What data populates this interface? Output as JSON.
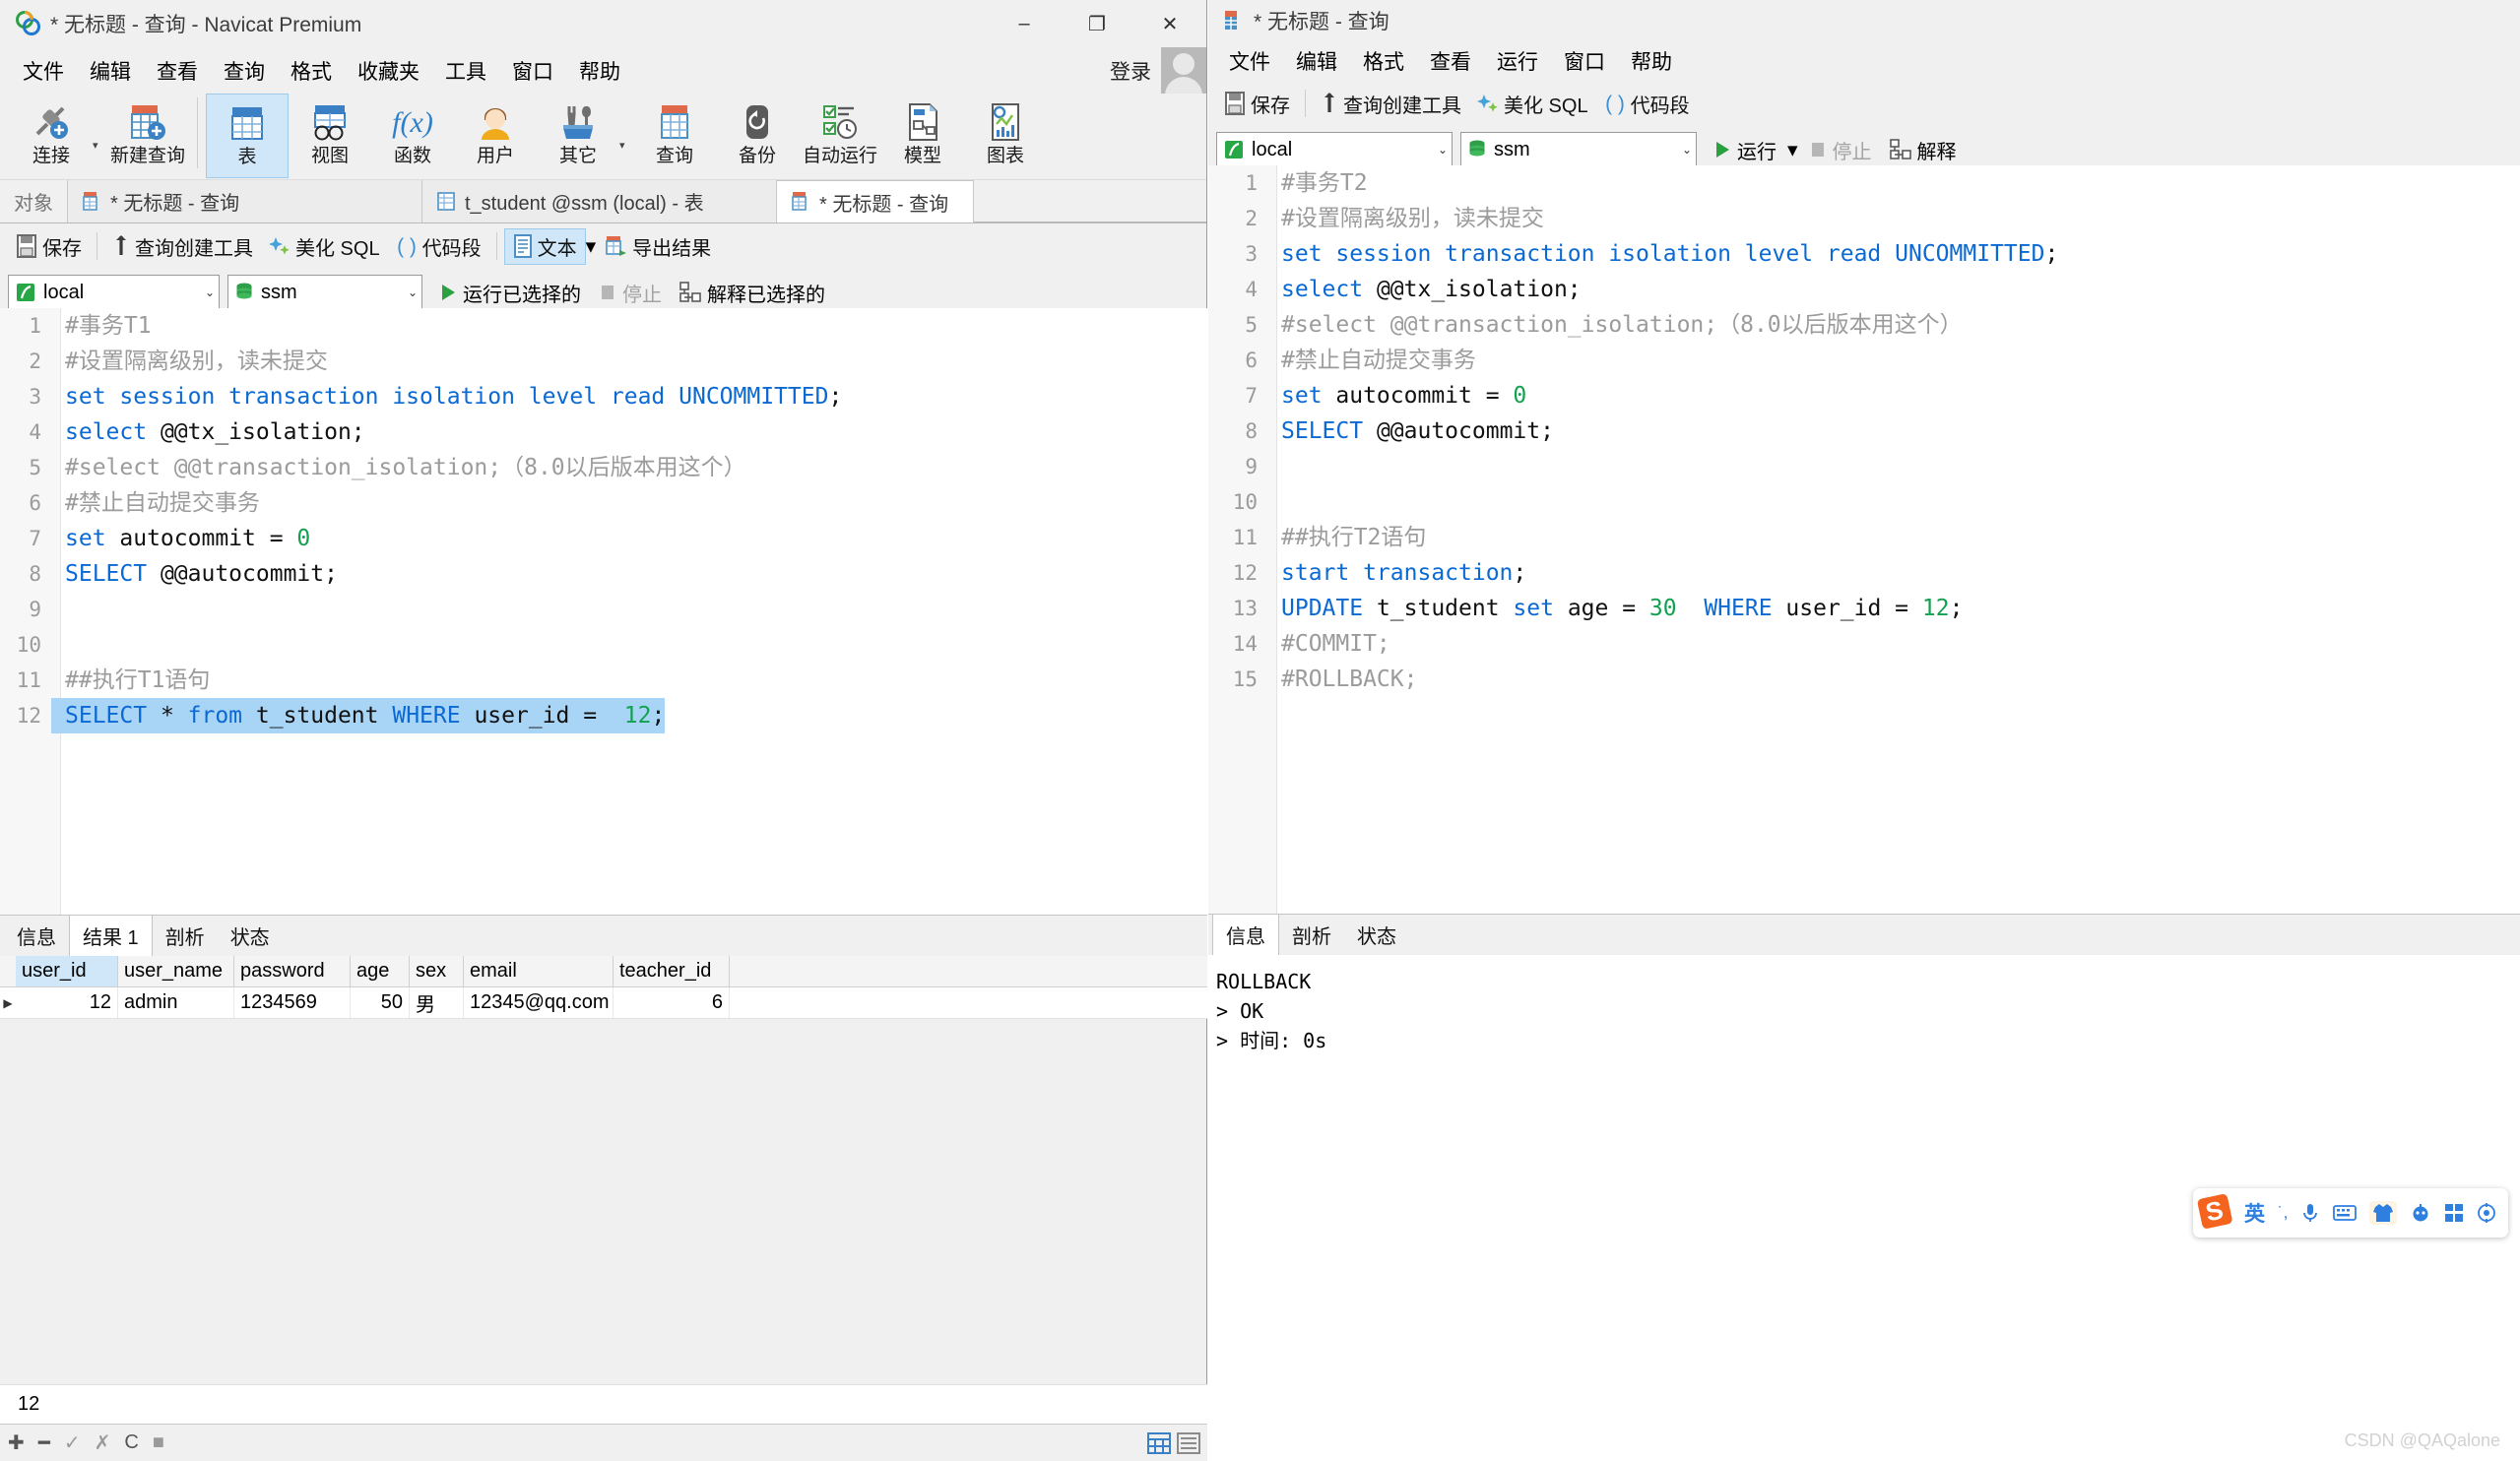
{
  "left_window": {
    "title": "* 无标题 - 查询 - Navicat Premium",
    "window_buttons": {
      "minimize": "–",
      "maximize": "❐",
      "close": "✕"
    },
    "menu": [
      "文件",
      "编辑",
      "查看",
      "查询",
      "格式",
      "收藏夹",
      "工具",
      "窗口",
      "帮助"
    ],
    "login_label": "登录",
    "toolbar": [
      {
        "label": "连接",
        "icon": "connection-icon",
        "caret": true
      },
      {
        "label": "新建查询",
        "icon": "new-query-icon",
        "caret": false
      },
      {
        "label": "表",
        "icon": "table-icon",
        "selected": true
      },
      {
        "label": "视图",
        "icon": "view-icon",
        "selected": false
      },
      {
        "label": "函数",
        "icon": "function-icon",
        "selected": false
      },
      {
        "label": "用户",
        "icon": "user-icon",
        "selected": false
      },
      {
        "label": "其它",
        "icon": "other-icon",
        "caret": true
      },
      {
        "label": "查询",
        "icon": "query-icon",
        "selected": false
      },
      {
        "label": "备份",
        "icon": "backup-icon",
        "selected": false
      },
      {
        "label": "自动运行",
        "icon": "automation-icon",
        "selected": false
      },
      {
        "label": "模型",
        "icon": "model-icon",
        "selected": false
      },
      {
        "label": "图表",
        "icon": "chart-icon",
        "selected": false
      }
    ],
    "tabs": [
      {
        "label": "对象",
        "icon": "object-icon",
        "active": false
      },
      {
        "label": "* 无标题 - 查询",
        "icon": "query-tab-icon",
        "active": false
      },
      {
        "label": "t_student @ssm (local) - 表",
        "icon": "table-tab-icon",
        "active": false
      },
      {
        "label": "* 无标题 - 查询",
        "icon": "query-tab-icon",
        "active": true
      }
    ],
    "subtoolbar": [
      {
        "label": "保存",
        "icon": "save-icon",
        "selected": false
      },
      {
        "label": "查询创建工具",
        "icon": "query-builder-icon",
        "selected": false
      },
      {
        "label": "美化 SQL",
        "icon": "beautify-sql-icon",
        "selected": false
      },
      {
        "label": "代码段",
        "icon": "code-snippet-icon",
        "selected": false
      },
      {
        "label": "文本",
        "icon": "text-icon",
        "selected": true,
        "caret": true
      },
      {
        "label": "导出结果",
        "icon": "export-result-icon",
        "selected": false
      }
    ],
    "connection": {
      "server": "local",
      "database": "ssm"
    },
    "run_buttons": [
      {
        "label": "运行已选择的",
        "icon": "play-icon",
        "disabled": false
      },
      {
        "label": "停止",
        "icon": "stop-icon",
        "disabled": true
      },
      {
        "label": "解释已选择的",
        "icon": "explain-icon",
        "disabled": false
      }
    ],
    "code_lines": [
      {
        "n": "1",
        "segs": [
          {
            "t": "#事务T1",
            "c": "cmt"
          }
        ]
      },
      {
        "n": "2",
        "segs": [
          {
            "t": "#设置隔离级别，读未提交",
            "c": "cmt"
          }
        ]
      },
      {
        "n": "3",
        "segs": [
          {
            "t": "set session transaction isolation level read UNCOMMITTED",
            "c": "kw"
          },
          {
            "t": ";",
            "c": "plain"
          }
        ]
      },
      {
        "n": "4",
        "segs": [
          {
            "t": "select",
            "c": "kw"
          },
          {
            "t": " @@tx_isolation;",
            "c": "plain"
          }
        ]
      },
      {
        "n": "5",
        "segs": [
          {
            "t": "#select @@transaction_isolation;（8.0以后版本用这个）",
            "c": "cmt"
          }
        ]
      },
      {
        "n": "6",
        "segs": [
          {
            "t": "#禁止自动提交事务",
            "c": "cmt"
          }
        ]
      },
      {
        "n": "7",
        "segs": [
          {
            "t": "set",
            "c": "kw"
          },
          {
            "t": " autocommit = ",
            "c": "plain"
          },
          {
            "t": "0",
            "c": "num"
          }
        ]
      },
      {
        "n": "8",
        "segs": [
          {
            "t": "SELECT",
            "c": "kw"
          },
          {
            "t": " @@autocommit;",
            "c": "plain"
          }
        ]
      },
      {
        "n": "9",
        "segs": []
      },
      {
        "n": "10",
        "segs": []
      },
      {
        "n": "11",
        "segs": [
          {
            "t": "##执行T1语句",
            "c": "cmt"
          }
        ]
      },
      {
        "n": "12",
        "segs": [
          {
            "t": "SELECT",
            "c": "kw"
          },
          {
            "t": " * ",
            "c": "plain"
          },
          {
            "t": "from",
            "c": "kw"
          },
          {
            "t": " t_student ",
            "c": "plain"
          },
          {
            "t": "WHERE",
            "c": "kw"
          },
          {
            "t": " user_id =  ",
            "c": "plain"
          },
          {
            "t": "12",
            "c": "num"
          },
          {
            "t": ";",
            "c": "plain"
          }
        ],
        "selected": true
      }
    ],
    "result_tabs": [
      {
        "label": "信息",
        "active": false
      },
      {
        "label": "结果 1",
        "active": true
      },
      {
        "label": "剖析",
        "active": false
      },
      {
        "label": "状态",
        "active": false
      }
    ],
    "result_grid": {
      "columns": [
        "user_id",
        "user_name",
        "password",
        "age",
        "sex",
        "email",
        "teacher_id"
      ],
      "rows": [
        [
          "12",
          "admin",
          "1234569",
          "50",
          "男",
          "12345@qq.com",
          "6"
        ]
      ]
    },
    "page_count": "12",
    "status_icons": [
      "add-record-icon",
      "delete-record-icon",
      "apply-change-icon",
      "cancel-change-icon",
      "refresh-icon",
      "stop-icon"
    ],
    "status_view_icons": [
      "grid-view-icon",
      "form-view-icon"
    ]
  },
  "right_window": {
    "title": "* 无标题 - 查询",
    "menu": [
      "文件",
      "编辑",
      "格式",
      "查看",
      "运行",
      "窗口",
      "帮助"
    ],
    "subtoolbar": [
      {
        "label": "保存",
        "icon": "save-icon"
      },
      {
        "label": "查询创建工具",
        "icon": "query-builder-icon"
      },
      {
        "label": "美化 SQL",
        "icon": "beautify-sql-icon"
      },
      {
        "label": "代码段",
        "icon": "code-snippet-icon"
      }
    ],
    "connection": {
      "server": "local",
      "database": "ssm"
    },
    "run_buttons": [
      {
        "label": "运行",
        "icon": "play-icon",
        "disabled": false,
        "caret": true
      },
      {
        "label": "停止",
        "icon": "stop-icon",
        "disabled": true
      },
      {
        "label": "解释",
        "icon": "explain-icon",
        "disabled": false
      }
    ],
    "code_lines": [
      {
        "n": "1",
        "segs": [
          {
            "t": "#事务T2",
            "c": "cmt"
          }
        ]
      },
      {
        "n": "2",
        "segs": [
          {
            "t": "#设置隔离级别，读未提交",
            "c": "cmt"
          }
        ]
      },
      {
        "n": "3",
        "segs": [
          {
            "t": "set session transaction isolation level read UNCOMMITTED",
            "c": "kw"
          },
          {
            "t": ";",
            "c": "plain"
          }
        ]
      },
      {
        "n": "4",
        "segs": [
          {
            "t": "select",
            "c": "kw"
          },
          {
            "t": " @@tx_isolation;",
            "c": "plain"
          }
        ]
      },
      {
        "n": "5",
        "segs": [
          {
            "t": "#select @@transaction_isolation;（8.0以后版本用这个）",
            "c": "cmt"
          }
        ]
      },
      {
        "n": "6",
        "segs": [
          {
            "t": "#禁止自动提交事务",
            "c": "cmt"
          }
        ]
      },
      {
        "n": "7",
        "segs": [
          {
            "t": "set",
            "c": "kw"
          },
          {
            "t": " autocommit = ",
            "c": "plain"
          },
          {
            "t": "0",
            "c": "num"
          }
        ]
      },
      {
        "n": "8",
        "segs": [
          {
            "t": "SELECT",
            "c": "kw"
          },
          {
            "t": " @@autocommit;",
            "c": "plain"
          }
        ]
      },
      {
        "n": "9",
        "segs": []
      },
      {
        "n": "10",
        "segs": []
      },
      {
        "n": "11",
        "segs": [
          {
            "t": "##执行T2语句",
            "c": "cmt"
          }
        ]
      },
      {
        "n": "12",
        "segs": [
          {
            "t": "start transaction",
            "c": "kw"
          },
          {
            "t": ";",
            "c": "plain"
          }
        ]
      },
      {
        "n": "13",
        "segs": [
          {
            "t": "UPDATE",
            "c": "kw"
          },
          {
            "t": " t_student ",
            "c": "plain"
          },
          {
            "t": "set",
            "c": "kw"
          },
          {
            "t": " age = ",
            "c": "plain"
          },
          {
            "t": "30",
            "c": "num"
          },
          {
            "t": "  ",
            "c": "plain"
          },
          {
            "t": "WHERE",
            "c": "kw"
          },
          {
            "t": " user_id = ",
            "c": "plain"
          },
          {
            "t": "12",
            "c": "num"
          },
          {
            "t": ";",
            "c": "plain"
          }
        ]
      },
      {
        "n": "14",
        "segs": [
          {
            "t": "#COMMIT;",
            "c": "cmt"
          }
        ]
      },
      {
        "n": "15",
        "segs": [
          {
            "t": "#ROLLBACK;",
            "c": "cmt"
          }
        ]
      }
    ],
    "result_tabs": [
      {
        "label": "信息",
        "active": true
      },
      {
        "label": "剖析",
        "active": false
      },
      {
        "label": "状态",
        "active": false
      }
    ],
    "message_lines": [
      "ROLLBACK",
      "> OK",
      "> 时间: 0s"
    ]
  },
  "ime": {
    "logo": "sogou-logo-icon",
    "items": [
      {
        "icon": "language-mode-icon",
        "label": "英",
        "highlight": false
      },
      {
        "icon": "punctuation-icon",
        "label": "·,",
        "highlight": false
      },
      {
        "icon": "microphone-icon",
        "label": "",
        "highlight": false
      },
      {
        "icon": "keyboard-icon",
        "label": "",
        "highlight": false
      },
      {
        "icon": "skin-icon",
        "label": "",
        "highlight": true
      },
      {
        "icon": "emoji-icon",
        "label": "",
        "highlight": false
      },
      {
        "icon": "apps-icon",
        "label": "",
        "highlight": false
      },
      {
        "icon": "settings-icon",
        "label": "",
        "highlight": false
      }
    ]
  },
  "watermark": "CSDN @QAQalone",
  "colors": {
    "accent": "#0b69d4",
    "keyword": "#0b69d4",
    "number": "#12a150",
    "comment": "#9b9b9b",
    "selection": "#a8d4f5",
    "toolbar_selected": "#cfe7f8"
  }
}
